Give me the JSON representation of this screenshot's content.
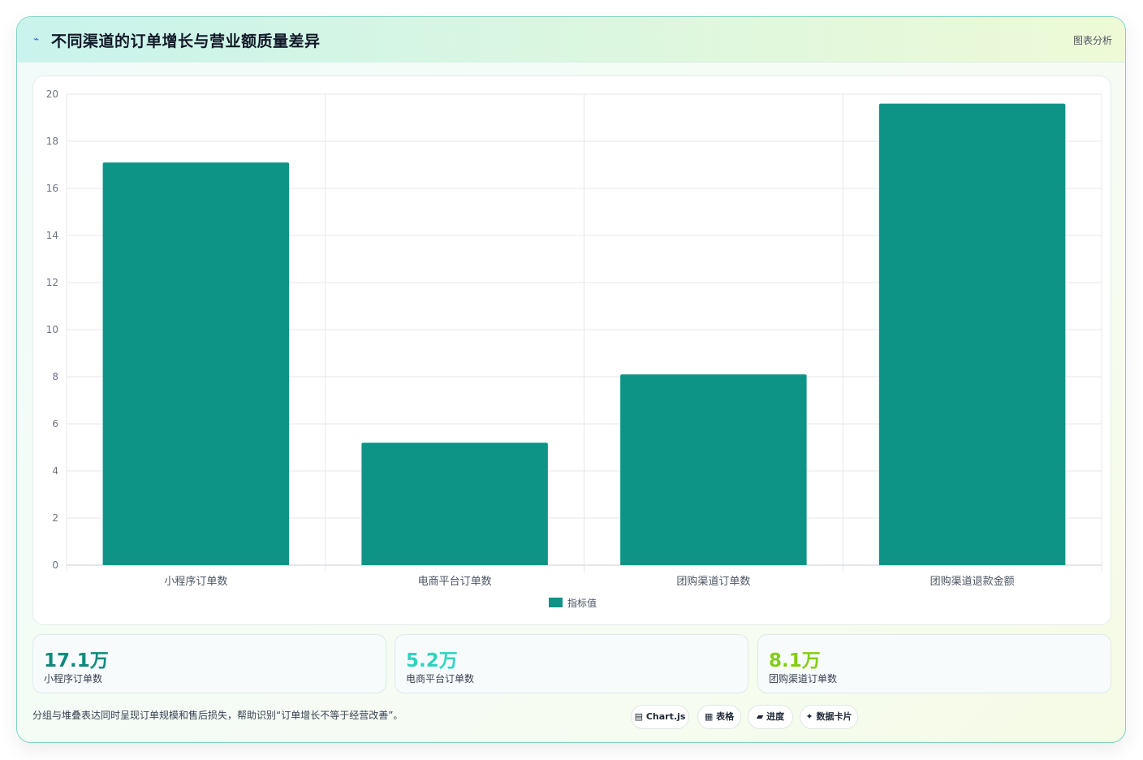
{
  "header": {
    "icon": "⌁",
    "title": "不同渠道的订单增长与营业额质量差异",
    "tag": "图表分析"
  },
  "chart_data": {
    "type": "bar",
    "categories": [
      "小程序订单数",
      "电商平台订单数",
      "团购渠道订单数",
      "团购渠道退款金额"
    ],
    "series": [
      {
        "name": "指标值",
        "values": [
          17.1,
          5.2,
          8.1,
          19.6
        ],
        "color": "#0e9486"
      }
    ],
    "ylim": [
      0,
      20
    ],
    "yticks": [
      0,
      2,
      4,
      6,
      8,
      10,
      12,
      14,
      16,
      18,
      20
    ],
    "grid": true,
    "legend_position": "bottom"
  },
  "stats": [
    {
      "value": "17.1万",
      "label": "小程序订单数",
      "color": "#0e8a7d"
    },
    {
      "value": "5.2万",
      "label": "电商平台订单数",
      "color": "#2dd4bf"
    },
    {
      "value": "8.1万",
      "label": "团购渠道订单数",
      "color": "#84cc16"
    }
  ],
  "footer": {
    "note": "分组与堆叠表达同时呈现订单规模和售后损失，帮助识别“订单增长不等于经营改善”。",
    "chips": [
      {
        "icon": "▤",
        "label": "Chart.js"
      },
      {
        "icon": "▦",
        "label": "表格"
      },
      {
        "icon": "▰",
        "label": "进度"
      },
      {
        "icon": "✦",
        "label": "数据卡片"
      }
    ]
  }
}
